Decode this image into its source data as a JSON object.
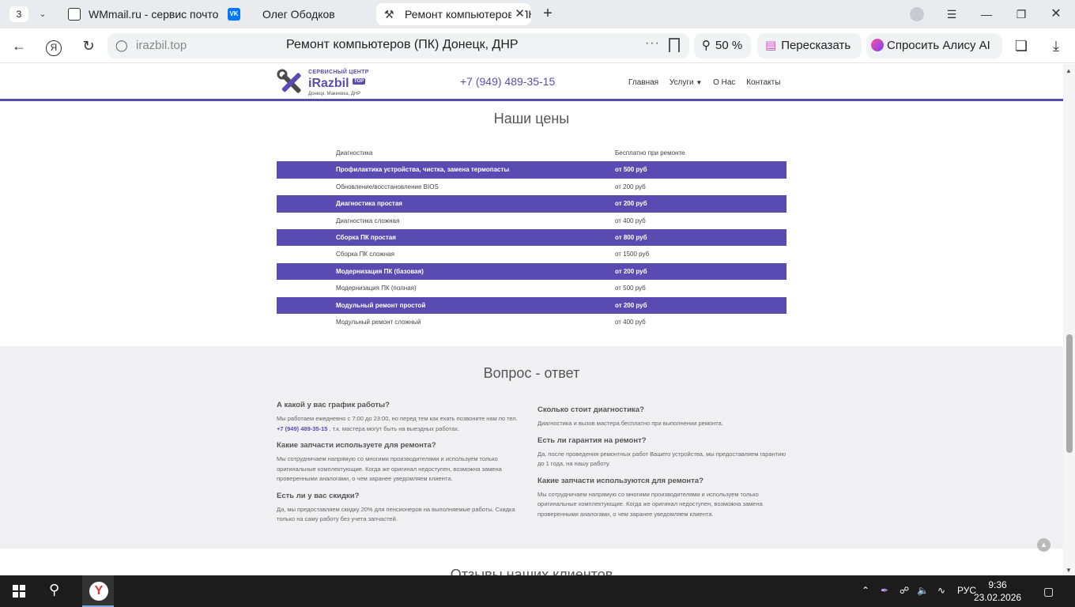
{
  "browser": {
    "tab_count": "3",
    "tabs": [
      {
        "title": "WMmail.ru - сервис почтовых рассылок",
        "icon": "document-icon"
      },
      {
        "title": "Олег Ободков",
        "icon": "vk-icon"
      },
      {
        "title": "Ремонт компьютеров (ПК) Донецк",
        "icon": "tools-icon"
      }
    ],
    "url_host": "irazbil.top",
    "page_title": "Ремонт компьютеров (ПК) Донецк, ДНР",
    "zoom": "50 %",
    "retell_label": "Пересказать",
    "alice_label": "Спросить Алису AI"
  },
  "site": {
    "logo": {
      "top": "СЕРВИСНЫЙ ЦЕНТР",
      "name": "iRazbil",
      "badge": "TOP",
      "sub": "Донецк, Макеевка, ДНР"
    },
    "phone": "+7 (949) 489-35-15",
    "menu": {
      "home": "Главная",
      "services": "Услуги",
      "about": "О Нас",
      "contacts": "Контакты"
    }
  },
  "prices": {
    "title": "Наши цены",
    "rows": [
      {
        "name": "Диагностика",
        "price": "Бесплатно при ремонте"
      },
      {
        "name": "Профилактика устройства, чистка, замена термопасты",
        "price": "от 500 руб"
      },
      {
        "name": "Обновление/восстановление BIOS",
        "price": "от 200 руб"
      },
      {
        "name": "Диагностика простая",
        "price": "от 200 руб"
      },
      {
        "name": "Диагностика сложная",
        "price": "от 400 руб"
      },
      {
        "name": "Сборка ПК простая",
        "price": "от 800 руб"
      },
      {
        "name": "Сборка ПК сложная",
        "price": "от 1500 руб"
      },
      {
        "name": "Модернизация ПК (базовая)",
        "price": "от 200 руб"
      },
      {
        "name": "Модернизация ПК (полная)",
        "price": "от 500 руб"
      },
      {
        "name": "Модульный ремонт простой",
        "price": "от 200 руб"
      },
      {
        "name": "Модульный ремонт сложный",
        "price": "от 400 руб"
      }
    ]
  },
  "faq": {
    "title": "Вопрос - ответ",
    "left": [
      {
        "q": "А какой у вас график работы?",
        "a_pre": "Мы работаем ежедневно с 7:00 до 23:00, но перед тем как ехать позвоните нам по тел.",
        "a_phone": "+7 (949) 489-35-15",
        "a_post": ", т.к. мастера могут быть на выездных работах."
      },
      {
        "q": "Какие запчасти используете для ремонта?",
        "a": "Мы сотрудничаем напрямую со многими производителями и используем только оригинальные комплектующие. Когда же оригинал недоступен, возможна замена проверенными аналогами, о чем заранее уведомляем клиента."
      },
      {
        "q": "Есть ли у вас скидки?",
        "a": "Да, мы предоставляем скидку 20% для пенсионеров на выполняемые работы. Скидка только на саму работу без учета запчастей."
      }
    ],
    "right": [
      {
        "q": "Сколько стоит диагностика?",
        "a": "Диагностика и вызов мастера бесплатно при выполнении ремонта."
      },
      {
        "q": "Есть ли гарантия на ремонт?",
        "a": "Да, после проведения ремонтных работ Вашего устройства, мы предоставляем гарантию до 1 года, на нашу работу."
      },
      {
        "q": "Какие запчасти используются для ремонта?",
        "a": "Мы сотрудничаем напрямую со многими производителями и используем только оригинальные комплектующие. Когда же оригинал недоступен, возможна замена проверенными аналогами, о чем заранее уведомляем клиента."
      }
    ]
  },
  "reviews_title": "Отзывы наших клиентов",
  "taskbar": {
    "lang": "РУС",
    "time": "9:36",
    "date": "23.02.2026"
  },
  "colors": {
    "accent": "#5a4bb3",
    "faq_bg": "#f0f0f2"
  }
}
